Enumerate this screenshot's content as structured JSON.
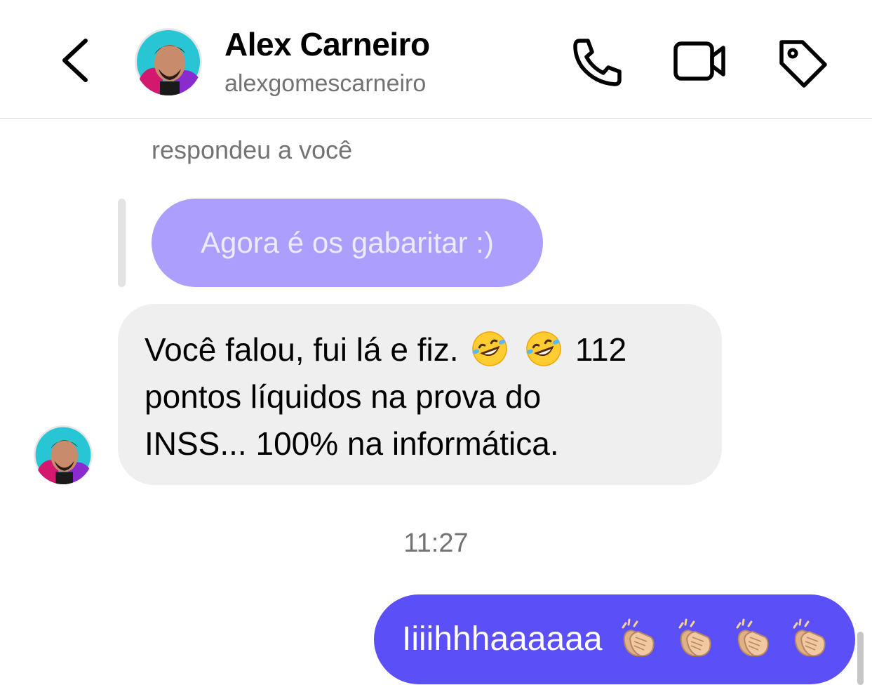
{
  "header": {
    "name": "Alex Carneiro",
    "username": "alexgomescarneiro",
    "icons": [
      "back-chevron-icon",
      "phone-icon",
      "video-camera-icon",
      "tag-icon"
    ]
  },
  "thread": {
    "reply_caption": "respondeu a você",
    "quoted_message": "Agora é os gabaritar :)",
    "incoming": {
      "line1_text": "Você falou, fui lá e fiz.",
      "line1_emojis": [
        "rolling-on-floor-laughing-emoji",
        "rolling-on-floor-laughing-emoji"
      ],
      "line1_tail": "112",
      "line2": "pontos líquidos na prova do",
      "line3": "INSS... 100% na informática."
    },
    "timestamp": "11:27",
    "outgoing": {
      "text": "Iiiihhhaaaaaa",
      "emojis": [
        "clapping-hands-emoji",
        "clapping-hands-emoji",
        "clapping-hands-emoji",
        "clapping-hands-emoji"
      ]
    }
  },
  "colors": {
    "quoted_bubble": "#ab9efd",
    "outgoing_bubble": "#5b4ff7",
    "incoming_bubble": "#efefef",
    "secondary_text": "#737373"
  }
}
